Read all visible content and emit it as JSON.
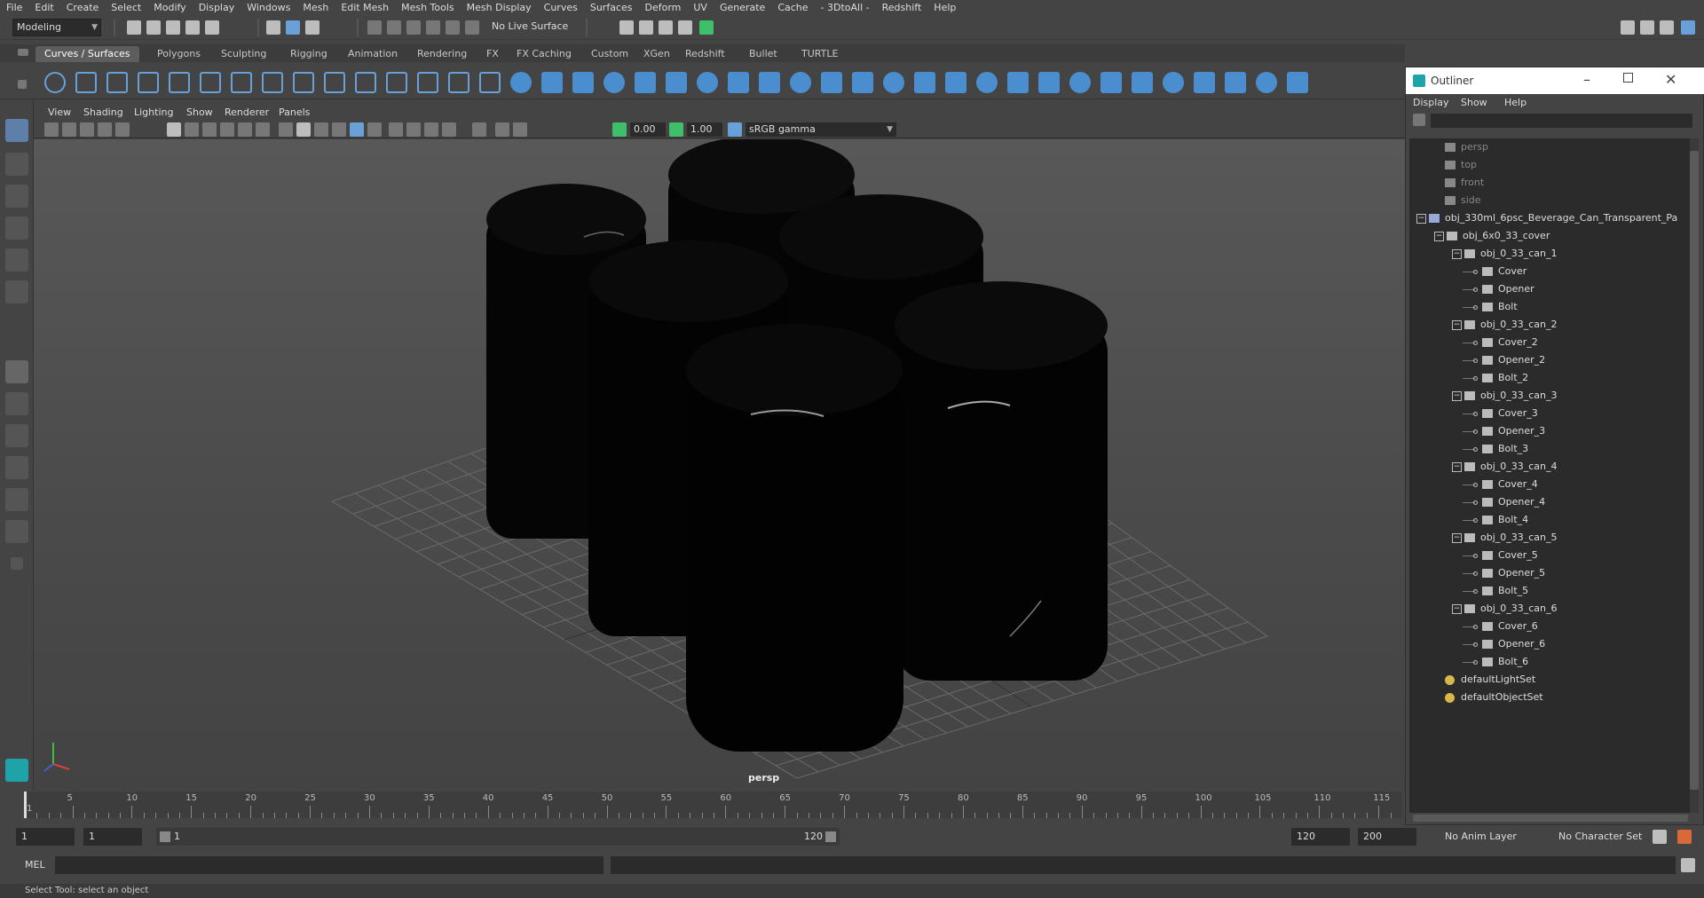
{
  "menubar": [
    "File",
    "Edit",
    "Create",
    "Select",
    "Modify",
    "Display",
    "Windows",
    "Mesh",
    "Edit Mesh",
    "Mesh Tools",
    "Mesh Display",
    "Curves",
    "Surfaces",
    "Deform",
    "UV",
    "Generate",
    "Cache",
    "- 3DtoAll -",
    "Redshift",
    "Help"
  ],
  "status": {
    "workspace": "Modeling",
    "live_surface": "No Live Surface"
  },
  "shelf_tabs": [
    "Curves / Surfaces",
    "Polygons",
    "Sculpting",
    "Rigging",
    "Animation",
    "Rendering",
    "FX",
    "FX Caching",
    "Custom",
    "XGen",
    "Redshift",
    "Bullet",
    "TURTLE"
  ],
  "viewport": {
    "menu": [
      "View",
      "Shading",
      "Lighting",
      "Show",
      "Renderer",
      "Panels"
    ],
    "exposure": "0.00",
    "gamma": "1.00",
    "color_space": "sRGB gamma",
    "camera_label": "persp"
  },
  "outliner": {
    "title": "Outliner",
    "menu": [
      "Display",
      "Show",
      "Help"
    ],
    "items": [
      {
        "label": "persp",
        "level": 0,
        "type": "camera"
      },
      {
        "label": "top",
        "level": 0,
        "type": "camera"
      },
      {
        "label": "front",
        "level": 0,
        "type": "camera"
      },
      {
        "label": "side",
        "level": 0,
        "type": "camera"
      },
      {
        "label": "obj_330ml_6psc_Beverage_Can_Transparent_Pa",
        "level": 0,
        "type": "root"
      },
      {
        "label": "obj_6x0_33_cover",
        "level": 1,
        "type": "group"
      },
      {
        "label": "obj_0_33_can_1",
        "level": 2,
        "type": "group"
      },
      {
        "label": "Cover",
        "level": 3,
        "type": "mesh"
      },
      {
        "label": "Opener",
        "level": 3,
        "type": "mesh"
      },
      {
        "label": "Bolt",
        "level": 3,
        "type": "mesh"
      },
      {
        "label": "obj_0_33_can_2",
        "level": 2,
        "type": "group"
      },
      {
        "label": "Cover_2",
        "level": 3,
        "type": "mesh"
      },
      {
        "label": "Opener_2",
        "level": 3,
        "type": "mesh"
      },
      {
        "label": "Bolt_2",
        "level": 3,
        "type": "mesh"
      },
      {
        "label": "obj_0_33_can_3",
        "level": 2,
        "type": "group"
      },
      {
        "label": "Cover_3",
        "level": 3,
        "type": "mesh"
      },
      {
        "label": "Opener_3",
        "level": 3,
        "type": "mesh"
      },
      {
        "label": "Bolt_3",
        "level": 3,
        "type": "mesh"
      },
      {
        "label": "obj_0_33_can_4",
        "level": 2,
        "type": "group"
      },
      {
        "label": "Cover_4",
        "level": 3,
        "type": "mesh"
      },
      {
        "label": "Opener_4",
        "level": 3,
        "type": "mesh"
      },
      {
        "label": "Bolt_4",
        "level": 3,
        "type": "mesh"
      },
      {
        "label": "obj_0_33_can_5",
        "level": 2,
        "type": "group"
      },
      {
        "label": "Cover_5",
        "level": 3,
        "type": "mesh"
      },
      {
        "label": "Opener_5",
        "level": 3,
        "type": "mesh"
      },
      {
        "label": "Bolt_5",
        "level": 3,
        "type": "mesh"
      },
      {
        "label": "obj_0_33_can_6",
        "level": 2,
        "type": "group"
      },
      {
        "label": "Cover_6",
        "level": 3,
        "type": "mesh"
      },
      {
        "label": "Opener_6",
        "level": 3,
        "type": "mesh"
      },
      {
        "label": "Bolt_6",
        "level": 3,
        "type": "mesh"
      },
      {
        "label": "defaultLightSet",
        "level": 0,
        "type": "set"
      },
      {
        "label": "defaultObjectSet",
        "level": 0,
        "type": "set"
      }
    ]
  },
  "timeline": {
    "ticks": [
      "1",
      "5",
      "10",
      "15",
      "20",
      "25",
      "30",
      "35",
      "40",
      "45",
      "50",
      "55",
      "60",
      "65",
      "70",
      "75",
      "80",
      "85",
      "90",
      "95",
      "100",
      "105",
      "110",
      "115"
    ],
    "current_frame": "1"
  },
  "range": {
    "start": "1",
    "anim_start": "1",
    "range_start": "1",
    "range_end": "120",
    "anim_end": "120",
    "end": "200",
    "anim_layer": "No Anim Layer",
    "character_set": "No Character Set"
  },
  "command": {
    "language": "MEL"
  },
  "help_line": "Select Tool: select an object"
}
